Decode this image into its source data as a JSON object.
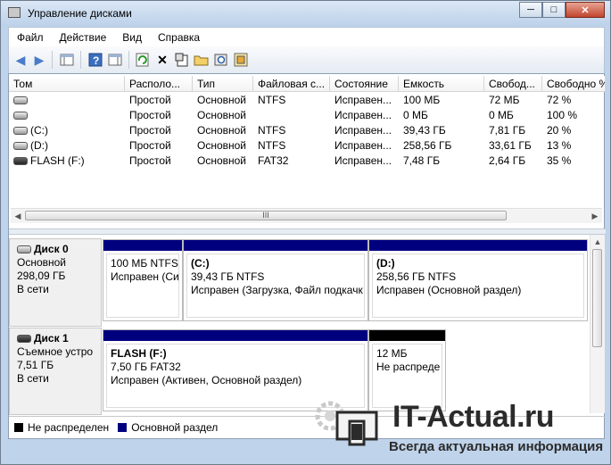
{
  "window": {
    "title": "Управление дисками",
    "buttons": [
      "─",
      "□",
      "✕"
    ]
  },
  "menu": [
    "Файл",
    "Действие",
    "Вид",
    "Справка"
  ],
  "toolbar": {
    "icons": [
      "back-arrow-icon",
      "forward-arrow-icon",
      "properties-pane-icon",
      "help-icon",
      "console-tree-icon",
      "refresh-icon",
      "delete-icon",
      "properties-icon",
      "open-folder-icon",
      "search-disk-icon",
      "export-icon"
    ]
  },
  "columns": [
    "Том",
    "Располо...",
    "Тип",
    "Файловая с...",
    "Состояние",
    "Емкость",
    "Свобод...",
    "Свободно %"
  ],
  "volumes": [
    {
      "name": "",
      "layout": "Простой",
      "type": "Основной",
      "fs": "NTFS",
      "status": "Исправен...",
      "capacity": "100 МБ",
      "free": "72 МБ",
      "free_pct": "72 %"
    },
    {
      "name": "",
      "layout": "Простой",
      "type": "Основной",
      "fs": "",
      "status": "Исправен...",
      "capacity": "0 МБ",
      "free": "0 МБ",
      "free_pct": "100 %"
    },
    {
      "name": "(C:)",
      "layout": "Простой",
      "type": "Основной",
      "fs": "NTFS",
      "status": "Исправен...",
      "capacity": "39,43 ГБ",
      "free": "7,81 ГБ",
      "free_pct": "20 %"
    },
    {
      "name": "(D:)",
      "layout": "Простой",
      "type": "Основной",
      "fs": "NTFS",
      "status": "Исправен...",
      "capacity": "258,56 ГБ",
      "free": "33,61 ГБ",
      "free_pct": "13 %"
    },
    {
      "name": "FLASH (F:)",
      "layout": "Простой",
      "type": "Основной",
      "fs": "FAT32",
      "status": "Исправен...",
      "capacity": "7,48 ГБ",
      "free": "2,64 ГБ",
      "free_pct": "35 %"
    }
  ],
  "hscroll_grip": "III",
  "disks": [
    {
      "name": "Диск 0",
      "type": "Основной",
      "size": "298,09 ГБ",
      "state": "В сети",
      "partitions": [
        {
          "title": "",
          "size": "100 МБ NTFS",
          "status": "Исправен (Си"
        },
        {
          "title": "(C:)",
          "size": "39,43 ГБ NTFS",
          "status": "Исправен (Загрузка, Файл подкачк"
        },
        {
          "title": "(D:)",
          "size": "258,56 ГБ NTFS",
          "status": "Исправен (Основной раздел)"
        }
      ]
    },
    {
      "name": "Диск 1",
      "type": "Съемное устро",
      "size": "7,51 ГБ",
      "state": "В сети",
      "partitions": [
        {
          "title": "FLASH  (F:)",
          "size": "7,50 ГБ FAT32",
          "status": "Исправен (Активен, Основной раздел)"
        },
        {
          "title": "",
          "size": "12 МБ",
          "status": "Не распреде"
        }
      ]
    }
  ],
  "legend": [
    {
      "label": "Не распределен",
      "color": "#000000"
    },
    {
      "label": "Основной раздел",
      "color": "#00007f"
    }
  ],
  "watermark": {
    "brand": "IT-Actual.ru",
    "tagline": "Всегда актуальная информация"
  },
  "colors": {
    "primary_partition": "#00007f",
    "unallocated": "#000000"
  }
}
